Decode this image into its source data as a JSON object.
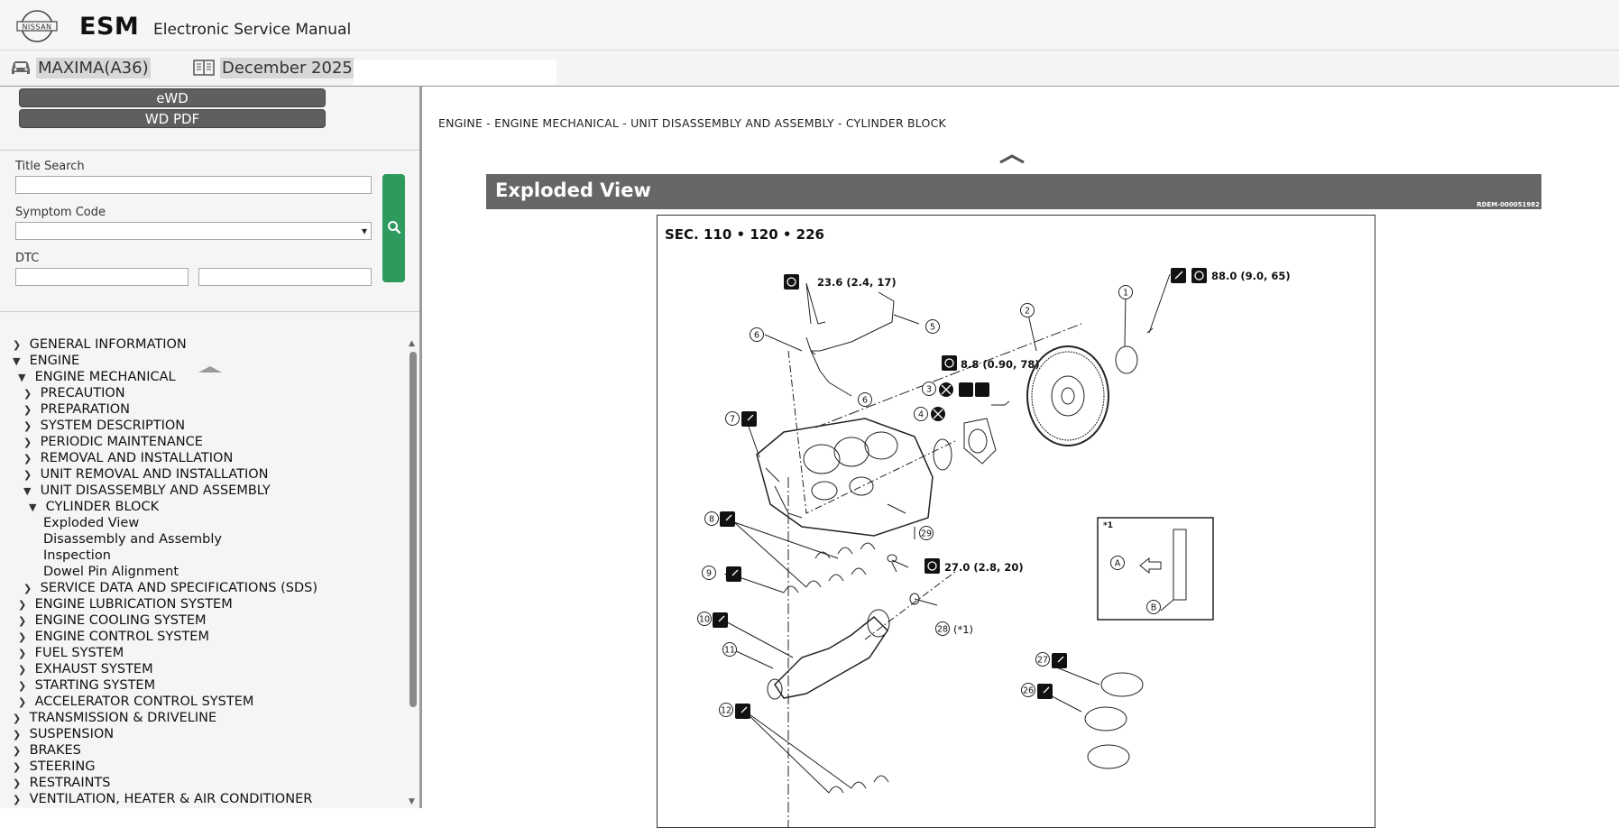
{
  "app": {
    "brand": "NISSAN",
    "title": "ESM",
    "subtitle": "Electronic Service Manual"
  },
  "vehicle": {
    "model": "MAXIMA(A36)",
    "version": "December 2025"
  },
  "sidebar": {
    "ewd_label": "eWD",
    "wdpdf_label": "WD PDF",
    "title_search_label": "Title Search",
    "symptom_label": "Symptom Code",
    "dtc_label": "DTC"
  },
  "tree": [
    {
      "label": "GENERAL INFORMATION",
      "expanded": false
    },
    {
      "label": "ENGINE",
      "expanded": true
    },
    {
      "label": "ENGINE MECHANICAL",
      "expanded": true
    },
    {
      "label": "PRECAUTION",
      "expanded": false
    },
    {
      "label": "PREPARATION",
      "expanded": false
    },
    {
      "label": "SYSTEM DESCRIPTION",
      "expanded": false
    },
    {
      "label": "PERIODIC MAINTENANCE",
      "expanded": false
    },
    {
      "label": "REMOVAL AND INSTALLATION",
      "expanded": false
    },
    {
      "label": "UNIT REMOVAL AND INSTALLATION",
      "expanded": false
    },
    {
      "label": "UNIT DISASSEMBLY AND ASSEMBLY",
      "expanded": true
    },
    {
      "label": "CYLINDER BLOCK",
      "expanded": true
    },
    {
      "label": "Exploded View"
    },
    {
      "label": "Disassembly and Assembly"
    },
    {
      "label": "Inspection"
    },
    {
      "label": "Dowel Pin Alignment"
    },
    {
      "label": "SERVICE DATA AND SPECIFICATIONS (SDS)",
      "expanded": false
    },
    {
      "label": "ENGINE LUBRICATION SYSTEM",
      "expanded": false
    },
    {
      "label": "ENGINE COOLING SYSTEM",
      "expanded": false
    },
    {
      "label": "ENGINE CONTROL SYSTEM",
      "expanded": false
    },
    {
      "label": "FUEL SYSTEM",
      "expanded": false
    },
    {
      "label": "EXHAUST SYSTEM",
      "expanded": false
    },
    {
      "label": "STARTING SYSTEM",
      "expanded": false
    },
    {
      "label": "ACCELERATOR CONTROL SYSTEM",
      "expanded": false
    },
    {
      "label": "TRANSMISSION & DRIVELINE",
      "expanded": false
    },
    {
      "label": "SUSPENSION",
      "expanded": false
    },
    {
      "label": "BRAKES",
      "expanded": false
    },
    {
      "label": "STEERING",
      "expanded": false
    },
    {
      "label": "RESTRAINTS",
      "expanded": false
    },
    {
      "label": "VENTILATION, HEATER & AIR CONDITIONER",
      "expanded": false
    }
  ],
  "content": {
    "breadcrumb": "ENGINE - ENGINE MECHANICAL - UNIT DISASSEMBLY AND ASSEMBLY - CYLINDER BLOCK",
    "page_title": "Exploded View",
    "doc_code": "RDEM-000051982",
    "diagram": {
      "section": "SEC. 110 • 120 • 226",
      "torques": {
        "t1": "23.6 (2.4, 17)",
        "t2": "88.0 (9.0, 65)",
        "t3": "8.8 (0.90, 78)",
        "t4": "27.0 (2.8, 20)"
      },
      "note_ref": "(*1)",
      "inset_ref": "*1",
      "callouts": [
        "1",
        "2",
        "3",
        "4",
        "5",
        "6",
        "6",
        "7",
        "8",
        "9",
        "10",
        "11",
        "12",
        "26",
        "27",
        "28",
        "29",
        "A",
        "B"
      ]
    }
  },
  "colors": {
    "header_bg": "#f6f6f6",
    "title_bar": "#666666",
    "button_dark": "#5f5f5f",
    "search_green": "#2e9a5e"
  }
}
